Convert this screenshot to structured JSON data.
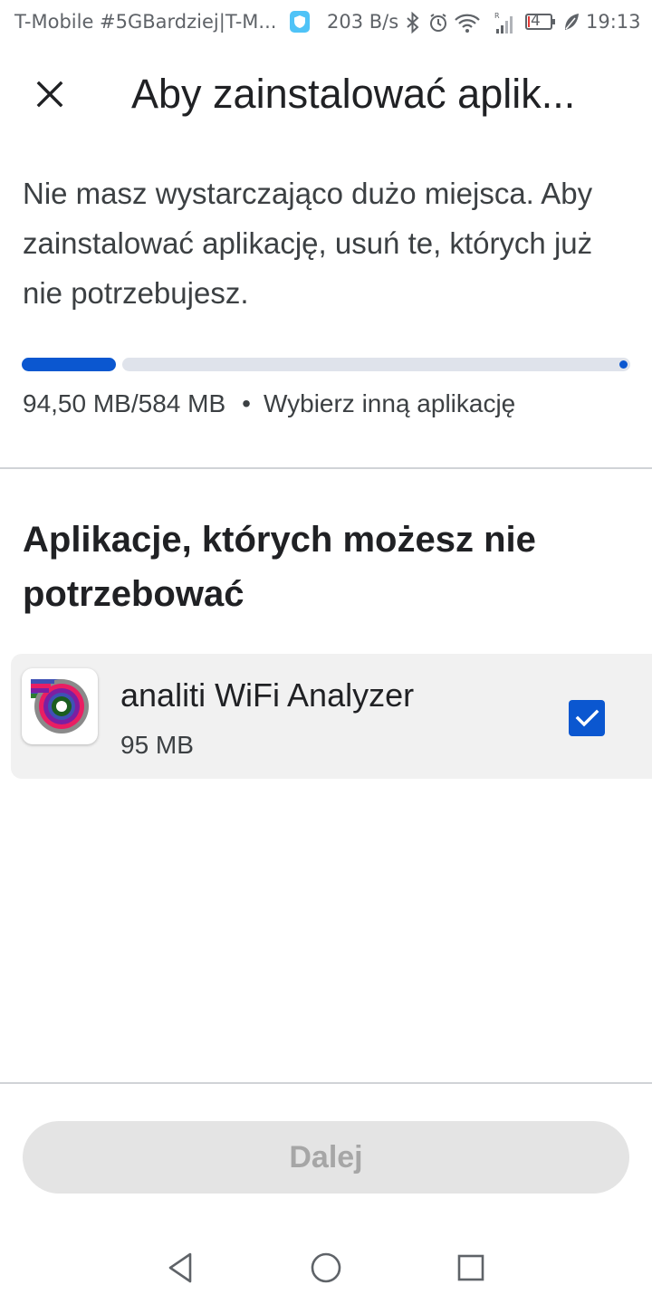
{
  "status_bar": {
    "carrier": "T-Mobile #5GBardziej|T-M...",
    "speed": "203 B/s",
    "battery_level": "4",
    "time": "19:13"
  },
  "header": {
    "title": "Aby zainstalować aplik...",
    "close_icon": "close-icon"
  },
  "message": "Nie masz wystarczająco dużo miejsca. Aby zainstalować aplikację, usuń te, których już nie potrzebujesz.",
  "storage": {
    "used_fraction": 0.16,
    "summary": "94,50 MB/584 MB",
    "separator": "•",
    "choose_other": "Wybierz inną aplikację"
  },
  "section": {
    "title": "Aplikacje, których możesz nie potrzebować"
  },
  "apps": [
    {
      "name": "analiti WiFi Analyzer",
      "size": "95 MB",
      "checked": true
    }
  ],
  "actions": {
    "next_label": "Dalej"
  },
  "colors": {
    "accent": "#0b57d0",
    "track": "#dfe3eb",
    "disabled_bg": "#e4e4e4",
    "disabled_text": "#a6a6a6"
  }
}
